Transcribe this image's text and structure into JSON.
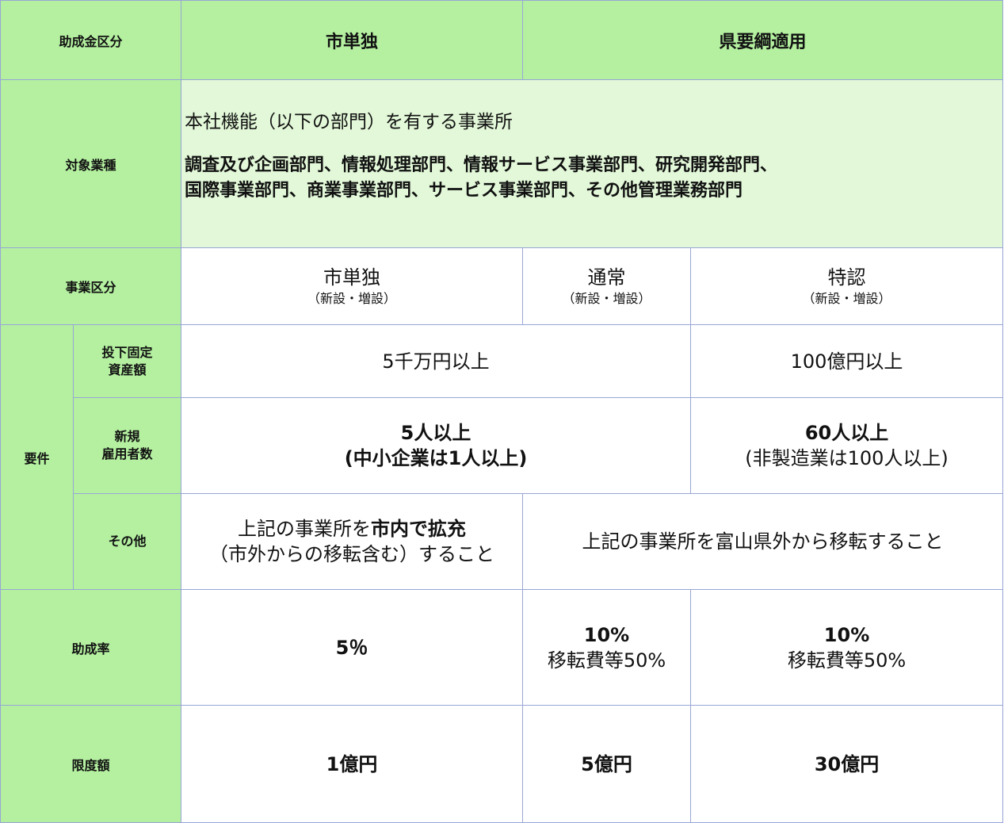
{
  "header": {
    "label": "助成金区分",
    "col_city": "市単独",
    "col_pref": "県要綱適用"
  },
  "target": {
    "label": "対象業種",
    "intro": "本社機能（以下の部門）を有する事業所",
    "departments_line1": "調査及び企画部門、情報処理部門、情報サービス事業部門、研究開発部門、",
    "departments_line2": "国際事業部門、商業事業部門、サービス事業部門、その他管理業務部門"
  },
  "category": {
    "label": "事業区分",
    "city": {
      "title": "市単独",
      "sub": "（新設・増設）"
    },
    "normal": {
      "title": "通常",
      "sub": "（新設・増設）"
    },
    "special": {
      "title": "特認",
      "sub": "（新設・増設）"
    }
  },
  "requirements": {
    "label": "要件",
    "investment": {
      "label_line1": "投下固定",
      "label_line2": "資産額",
      "city_normal": "5千万円以上",
      "special": "100億円以上"
    },
    "employment": {
      "label_line1": "新規",
      "label_line2": "雇用者数",
      "city_normal_line1": "5人以上",
      "city_normal_line2": "(中小企業は1人以上)",
      "special_line1": "60人以上",
      "special_line2": "(非製造業は100人以上)"
    },
    "other": {
      "label": "その他",
      "city_prefix": "上記の事業所を",
      "city_bold": "市内で拡充",
      "city_line2": "（市外からの移転含む）すること",
      "pref": "上記の事業所を富山県外から移転すること"
    }
  },
  "rate": {
    "label": "助成率",
    "city": "5％",
    "normal_main": "10%",
    "normal_sub": "移転費等50%",
    "special_main": "10%",
    "special_sub": "移転費等50%"
  },
  "limit": {
    "label": "限度額",
    "city": "1億円",
    "normal": "5億円",
    "special": "30億円"
  },
  "colors": {
    "header_green": "#b4f0a0",
    "light_green": "#e2f8d8",
    "border": "#98a6d6"
  }
}
